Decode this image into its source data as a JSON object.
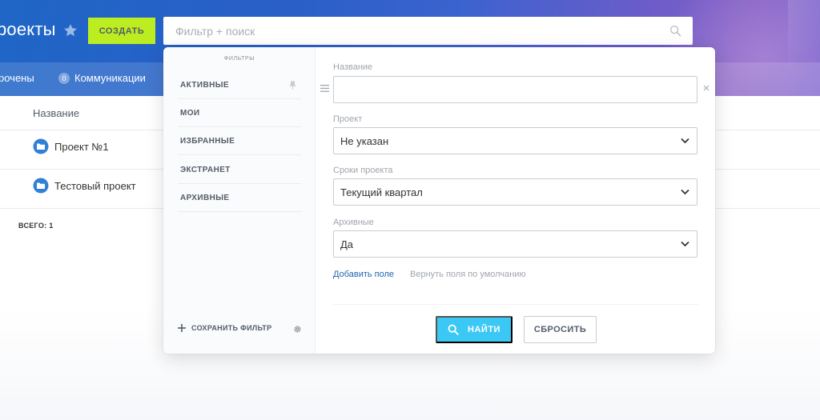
{
  "header": {
    "title": "роекты",
    "create_label": "СОЗДАТЬ",
    "search_placeholder": "Фильтр + поиск"
  },
  "subnav": {
    "items": [
      {
        "label": "рочены"
      },
      {
        "counter": "0",
        "label": "Коммуникации"
      }
    ]
  },
  "list": {
    "column_header": "Название",
    "rows": [
      {
        "label": "Проект №1"
      },
      {
        "label": "Тестовый проект"
      }
    ],
    "total": "ВСЕГО: 1"
  },
  "filter_popup": {
    "sidebar": {
      "title": "ФИЛЬТРЫ",
      "items": [
        {
          "label": "АКТИВНЫЕ"
        },
        {
          "label": "МОИ"
        },
        {
          "label": "ИЗБРАННЫЕ"
        },
        {
          "label": "ЭКСТРАНЕТ"
        },
        {
          "label": "АРХИВНЫЕ"
        }
      ],
      "save_label": "СОХРАНИТЬ ФИЛЬТР"
    },
    "fields": [
      {
        "label": "Название",
        "value": ""
      },
      {
        "label": "Проект",
        "value": "Не указан"
      },
      {
        "label": "Сроки проекта",
        "value": "Текущий квартал"
      },
      {
        "label": "Архивные",
        "value": "Да"
      }
    ],
    "add_field_label": "Добавить поле",
    "reset_fields_label": "Вернуть поля по умолчанию",
    "find_label": "НАЙТИ",
    "reset_label": "СБРОСИТЬ"
  },
  "colors": {
    "create_button": "#bbed21",
    "find_button": "#3bc8f5",
    "folder_icon": "#2f80d6",
    "link": "#2066b0"
  },
  "icons": [
    "star-icon",
    "search-icon",
    "folder-icon",
    "pin-icon",
    "plus-icon",
    "gear-icon",
    "chevron-down-icon",
    "drag-handle-icon",
    "clear-icon"
  ]
}
